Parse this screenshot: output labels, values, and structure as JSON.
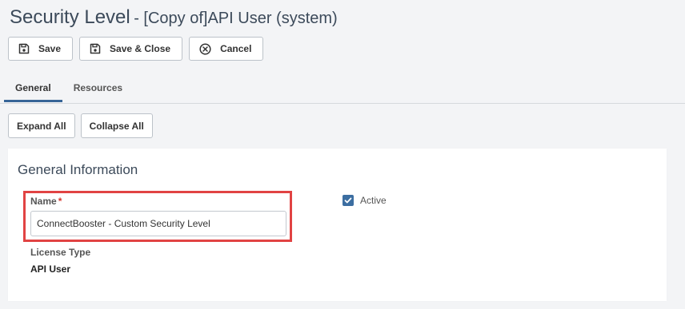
{
  "header": {
    "title": "Security Level",
    "subtitle": "- [Copy of]API User (system)"
  },
  "toolbar": {
    "save_label": "Save",
    "save_close_label": "Save & Close",
    "cancel_label": "Cancel"
  },
  "tabs": [
    {
      "label": "General",
      "active": true
    },
    {
      "label": "Resources",
      "active": false
    }
  ],
  "expand": {
    "expand_all_label": "Expand All",
    "collapse_all_label": "Collapse All"
  },
  "general": {
    "title": "General Information",
    "name": {
      "label": "Name",
      "required_marker": "*",
      "value": "ConnectBooster - Custom Security Level"
    },
    "active": {
      "label": "Active",
      "checked": true
    },
    "license": {
      "label": "License Type",
      "value": "API User"
    }
  },
  "colors": {
    "accent": "#376597",
    "checkbox": "#3c6ea1",
    "highlight": "#e14343",
    "required": "#d9352a"
  },
  "icons": {
    "save": "floppy-disk-icon",
    "save_close": "floppy-disk-icon",
    "cancel": "circle-x-icon",
    "checkbox": "check-icon"
  }
}
